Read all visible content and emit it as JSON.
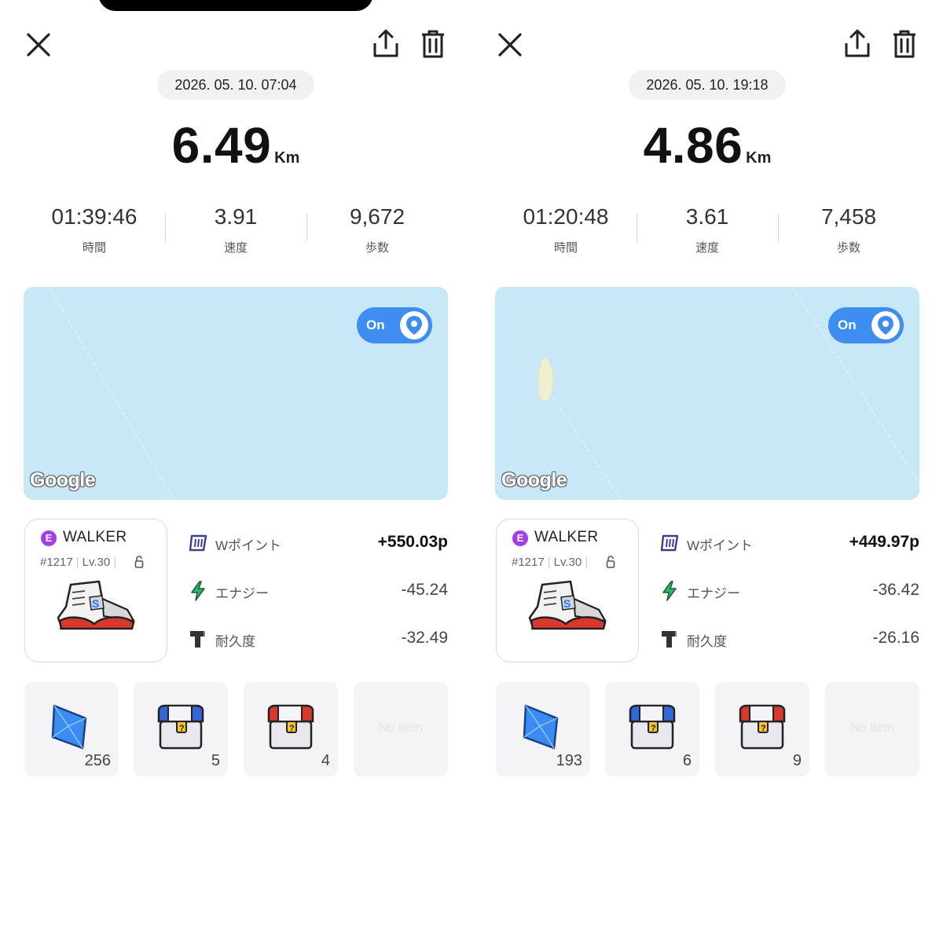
{
  "panels": [
    {
      "date": "2026. 05. 10. 07:04",
      "distance": "6.49",
      "distance_unit": "Km",
      "stats": [
        {
          "value": "01:39:46",
          "label": "時間"
        },
        {
          "value": "3.91",
          "label": "速度"
        },
        {
          "value": "9,672",
          "label": "歩数"
        }
      ],
      "map": {
        "toggle_label": "On",
        "attribution": "Google"
      },
      "shoe": {
        "badge": "E",
        "type": "WALKER",
        "id": "#1217",
        "level": "Lv.30"
      },
      "rewards": [
        {
          "icon": "w-point-icon",
          "label": "Wポイント",
          "value": "+550.03p"
        },
        {
          "icon": "energy-icon",
          "label": "エナジー",
          "value": "-45.24"
        },
        {
          "icon": "durability-icon",
          "label": "耐久度",
          "value": "-32.49"
        }
      ],
      "items": [
        {
          "icon": "blue-gem-icon",
          "count": "256"
        },
        {
          "icon": "blue-mystery-box-icon",
          "count": "5"
        },
        {
          "icon": "red-mystery-box-icon",
          "count": "4"
        },
        {
          "empty_label": "No Item"
        }
      ]
    },
    {
      "date": "2026. 05. 10. 19:18",
      "distance": "4.86",
      "distance_unit": "Km",
      "stats": [
        {
          "value": "01:20:48",
          "label": "時間"
        },
        {
          "value": "3.61",
          "label": "速度"
        },
        {
          "value": "7,458",
          "label": "歩数"
        }
      ],
      "map": {
        "toggle_label": "On",
        "attribution": "Google"
      },
      "shoe": {
        "badge": "E",
        "type": "WALKER",
        "id": "#1217",
        "level": "Lv.30"
      },
      "rewards": [
        {
          "icon": "w-point-icon",
          "label": "Wポイント",
          "value": "+449.97p"
        },
        {
          "icon": "energy-icon",
          "label": "エナジー",
          "value": "-36.42"
        },
        {
          "icon": "durability-icon",
          "label": "耐久度",
          "value": "-26.16"
        }
      ],
      "items": [
        {
          "icon": "blue-gem-icon",
          "count": "193"
        },
        {
          "icon": "blue-mystery-box-icon",
          "count": "6"
        },
        {
          "icon": "red-mystery-box-icon",
          "count": "9"
        },
        {
          "empty_label": "No Item"
        }
      ]
    }
  ],
  "colors": {
    "toggle": "#3d8ef0",
    "map_water": "#c8e7f7",
    "badge": "#a43ee6",
    "energy": "#2fb36a"
  }
}
